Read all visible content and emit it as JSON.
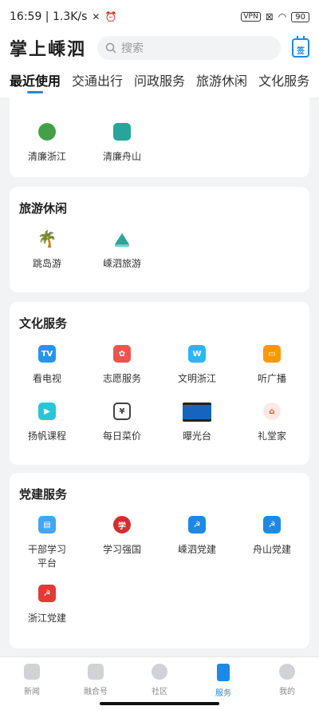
{
  "status": {
    "time_net": "16:59 | 1.3K/s",
    "vpn": "VPN",
    "battery": "90"
  },
  "header": {
    "logo": "掌上嵊泗",
    "search_placeholder": "搜索",
    "sign_label": "签"
  },
  "tabs": [
    "最近使用",
    "交通出行",
    "问政服务",
    "旅游休闲",
    "文化服务"
  ],
  "sections": {
    "partial": {
      "items": [
        {
          "label": "清廉浙江",
          "color": "#43a047"
        },
        {
          "label": "清廉舟山",
          "color": "#26a69a"
        }
      ]
    },
    "travel": {
      "title": "旅游休闲",
      "items": [
        {
          "label": "跳岛游",
          "color": "#29b6f6"
        },
        {
          "label": "嵊泗旅游",
          "color": "#26a69a"
        }
      ]
    },
    "culture": {
      "title": "文化服务",
      "items": [
        {
          "label": "看电视",
          "color": "#2196f3",
          "glyph": "TV"
        },
        {
          "label": "志愿服务",
          "color": "#ef5350"
        },
        {
          "label": "文明浙江",
          "color": "#29b6f6",
          "glyph": "W"
        },
        {
          "label": "听广播",
          "color": "#ff9800"
        },
        {
          "label": "扬帆课程",
          "color": "#26c6da"
        },
        {
          "label": "每日菜价",
          "color": "#424242"
        },
        {
          "label": "曝光台",
          "color": "#1565c0"
        },
        {
          "label": "礼堂家",
          "color": "#e64a19"
        }
      ]
    },
    "party": {
      "title": "党建服务",
      "items": [
        {
          "label": "干部学习\n平台",
          "color": "#42a5f5"
        },
        {
          "label": "学习强国",
          "color": "#d32f2f"
        },
        {
          "label": "嵊泗党建",
          "color": "#1e88e5"
        },
        {
          "label": "舟山党建",
          "color": "#1e88e5"
        },
        {
          "label": "浙江党建",
          "color": "#e53935"
        }
      ]
    }
  },
  "bottom_nav": [
    "新闻",
    "融合号",
    "社区",
    "服务",
    "我的"
  ]
}
